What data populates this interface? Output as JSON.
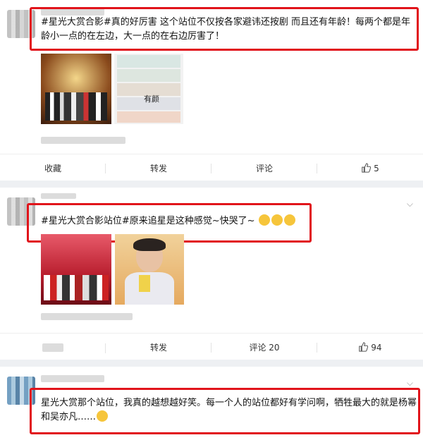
{
  "post1": {
    "line1": "#星光大赏合影#真的好厉害 这个站位不仅按各家避讳还按剧 而且还有年龄！每两个都是年",
    "line2": "龄小一点的在左边，大一点的在右边厉害了！",
    "collage_tag": "有颜",
    "actions": {
      "collect": "收藏",
      "repost": "转发",
      "comment": "评论",
      "like": "5"
    }
  },
  "post2": {
    "text": "#星光大赏合影站位#原来追星是这种感觉~快哭了~",
    "actions": {
      "repost": "转发",
      "comment": "评论 20",
      "like": "94"
    }
  },
  "post3": {
    "line1": "星光大赏那个站位，我真的越想越好笑。每一个人的站位都好有学问啊，牺牲最大的就是杨幂",
    "line2": "和吴亦凡……"
  },
  "colors": {
    "highlight": "#e1141b",
    "tag": "#eb7350",
    "link": "#2f5d96"
  }
}
